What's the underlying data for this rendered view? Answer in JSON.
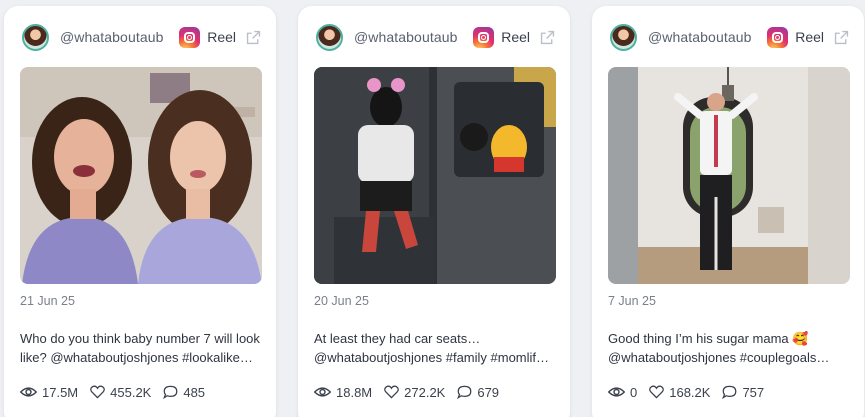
{
  "cards": [
    {
      "handle": "@whataboutaub",
      "type": "Reel",
      "date": "21 Jun 25",
      "caption_line1": "Who do you think baby number 7 will look",
      "caption_line2": "like? @whataboutjoshjones #lookalike…",
      "views": "17.5M",
      "likes": "455.2K",
      "comments": "485"
    },
    {
      "handle": "@whataboutaub",
      "type": "Reel",
      "date": "20 Jun 25",
      "caption_line1": "At least they had car seats…",
      "caption_line2": "@whataboutjoshjones #family #momlif…",
      "views": "18.8M",
      "likes": "272.2K",
      "comments": "679"
    },
    {
      "handle": "@whataboutaub",
      "type": "Reel",
      "date": "7 Jun 25",
      "caption_line1": "Good thing I’m his sugar mama 🥰",
      "caption_line2": "@whataboutjoshjones #couplegoals…",
      "views": "0",
      "likes": "168.2K",
      "comments": "757"
    }
  ],
  "icons": {
    "platform": "instagram-icon",
    "external": "external-link-icon",
    "views": "eye-icon",
    "likes": "heart-icon",
    "comments": "comment-icon"
  },
  "colors": {
    "background": "#eef0f4",
    "card": "#ffffff",
    "muted_text": "#7a808c"
  }
}
